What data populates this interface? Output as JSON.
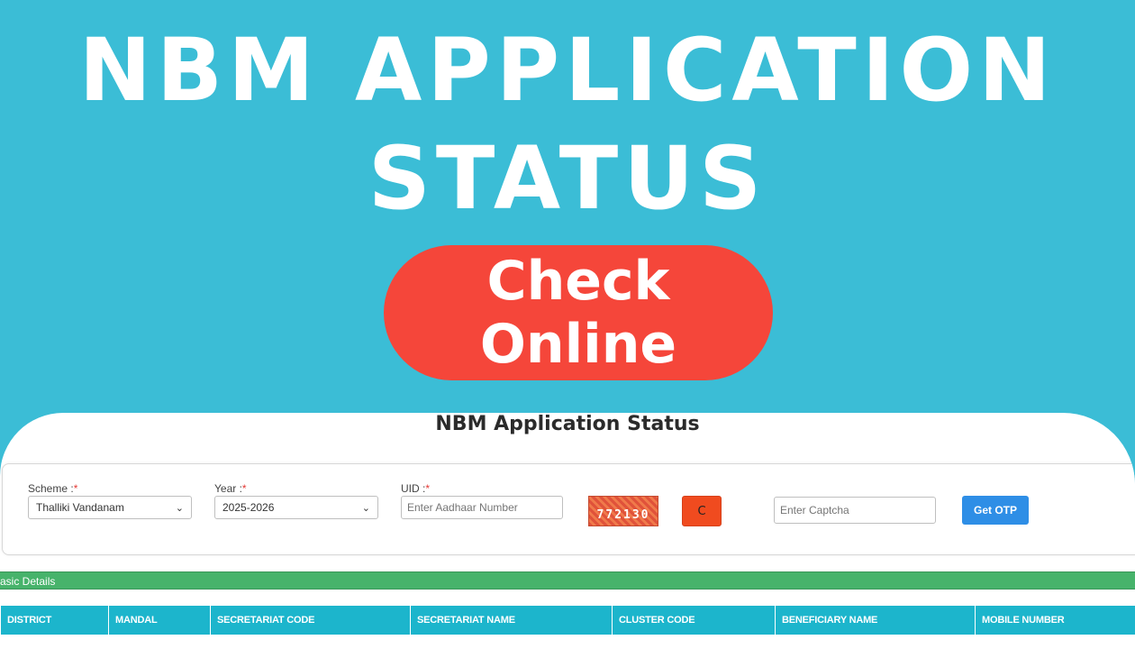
{
  "hero": {
    "line1": "NBM APPLICATION",
    "line2": "STATUS",
    "cta": "Check Online"
  },
  "card": {
    "title": "NBM Application Status"
  },
  "form": {
    "scheme": {
      "label": "Scheme :",
      "required": "*",
      "value": "Thalliki Vandanam"
    },
    "year": {
      "label": "Year :",
      "required": "*",
      "value": "2025-2026"
    },
    "uid": {
      "label": "UID :",
      "required": "*",
      "placeholder": "Enter Aadhaar Number"
    },
    "captcha_code": "772130",
    "refresh_glyph": "C",
    "captcha_input": {
      "placeholder": "Enter Captcha"
    },
    "otp_button": "Get OTP"
  },
  "section": {
    "title": "Basic Details"
  },
  "table": {
    "columns": [
      "DISTRICT",
      "MANDAL",
      "SECRETARIAT CODE",
      "SECRETARIAT NAME",
      "CLUSTER CODE",
      "BENEFICIARY NAME",
      "MOBILE NUMBER"
    ]
  },
  "colors": {
    "background": "#3bbdd6",
    "cta": "#f5463a",
    "section_bar": "#47b36b",
    "table_header": "#1cb5cc",
    "otp_button": "#2e8ee6",
    "refresh_button": "#f04b1f"
  }
}
